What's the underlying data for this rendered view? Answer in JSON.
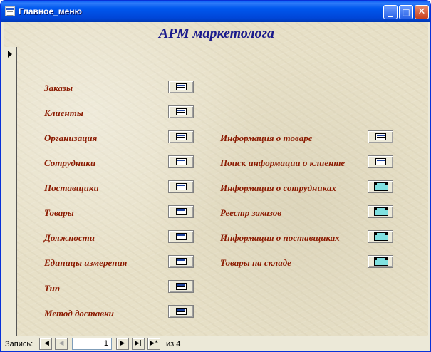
{
  "window": {
    "title": "Главное_меню"
  },
  "header": {
    "title": "АРМ маркетолога"
  },
  "left_menu": [
    {
      "label": "Заказы",
      "button_icon": "form-icon"
    },
    {
      "label": "Клиенты",
      "button_icon": "form-icon"
    },
    {
      "label": "Организация",
      "button_icon": "form-icon"
    },
    {
      "label": "Сотрудники",
      "button_icon": "form-icon"
    },
    {
      "label": "Поставщики",
      "button_icon": "form-icon"
    },
    {
      "label": "Товары",
      "button_icon": "form-icon"
    },
    {
      "label": "Должности",
      "button_icon": "form-icon"
    },
    {
      "label": "Единицы измерения",
      "button_icon": "form-icon"
    },
    {
      "label": "Тип",
      "button_icon": "form-icon"
    },
    {
      "label": "Метод доставки",
      "button_icon": "form-icon"
    }
  ],
  "right_menu": [
    {
      "label": "Информация о товаре",
      "button_icon": "form-icon"
    },
    {
      "label": "Поиск информации о клиенте",
      "button_icon": "form-icon"
    },
    {
      "label": "Информация о сотрудниках",
      "button_icon": "report-icon"
    },
    {
      "label": "Реестр заказов",
      "button_icon": "report-icon"
    },
    {
      "label": "Информация о поставщиках",
      "button_icon": "report-icon"
    },
    {
      "label": "Товары на складе",
      "button_icon": "report-icon"
    }
  ],
  "navigation": {
    "record_label": "Запись:",
    "current_record": "1",
    "of_label": "из",
    "total_records": "4"
  },
  "colors": {
    "title_bar": "#0054e3",
    "header_text": "#1a1a8c",
    "label_text": "#8b1a00",
    "form_background": "#e7e0c7"
  }
}
